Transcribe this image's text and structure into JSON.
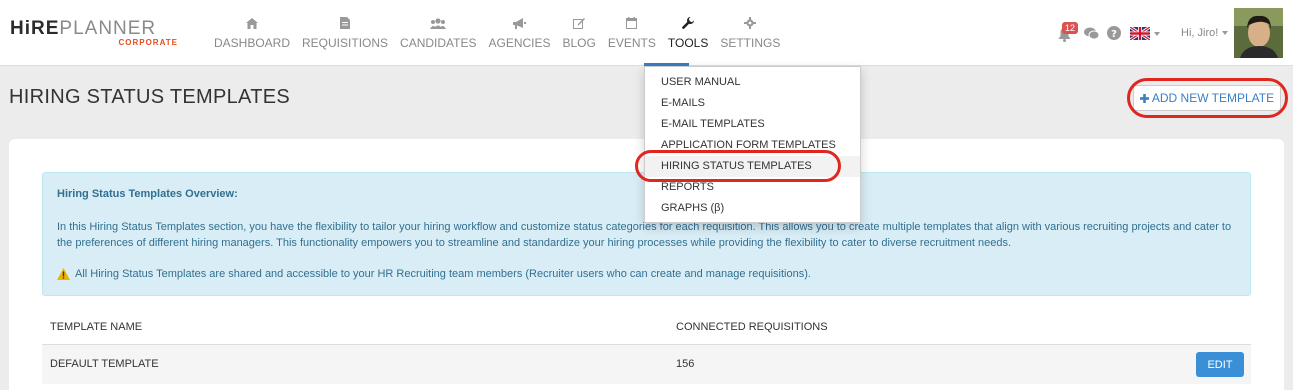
{
  "logo": {
    "hire": "HiRE",
    "planner": "PLANNER",
    "sub": "CORPORATE"
  },
  "nav": [
    {
      "label": "DASHBOARD",
      "icon": "home-icon"
    },
    {
      "label": "REQUISITIONS",
      "icon": "file-icon"
    },
    {
      "label": "CANDIDATES",
      "icon": "users-icon"
    },
    {
      "label": "AGENCIES",
      "icon": "megaphone-icon"
    },
    {
      "label": "BLOG",
      "icon": "edit-icon"
    },
    {
      "label": "EVENTS",
      "icon": "calendar-icon"
    },
    {
      "label": "TOOLS",
      "icon": "wrench-icon"
    },
    {
      "label": "SETTINGS",
      "icon": "gear-icon"
    }
  ],
  "header_right": {
    "notification_count": "12",
    "greeting": "Hi, Jiro!"
  },
  "page": {
    "title": "HIRING STATUS TEMPLATES",
    "add_button": "ADD NEW TEMPLATE"
  },
  "tools_menu": [
    "USER MANUAL",
    "E-MAILS",
    "E-MAIL TEMPLATES",
    "APPLICATION FORM TEMPLATES",
    "HIRING STATUS TEMPLATES",
    "REPORTS",
    "GRAPHS (β)"
  ],
  "info": {
    "title": "Hiring Status Templates Overview:",
    "paragraph": "In this Hiring Status Templates section, you have the flexibility to tailor your hiring workflow and customize status categories for each requisition. This allows you to create multiple templates that align with various recruiting projects and cater to the preferences of different hiring managers. This functionality empowers you to streamline and standardize your hiring processes while providing the flexibility to cater to diverse recruitment needs.",
    "warning": "All Hiring Status Templates are shared and accessible to your HR Recruiting team members (Recruiter users who can create and manage requisitions)."
  },
  "table": {
    "columns": [
      "TEMPLATE NAME",
      "CONNECTED REQUISITIONS"
    ],
    "rows": [
      {
        "name": "DEFAULT TEMPLATE",
        "connected": "156",
        "action": "EDIT"
      }
    ]
  }
}
